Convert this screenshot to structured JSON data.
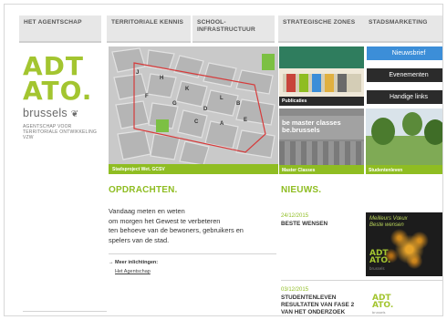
{
  "nav": {
    "items": [
      {
        "label": "HET AGENTSCHAP"
      },
      {
        "label": "TERRITORIALE KENNIS"
      },
      {
        "label": "SCHOOL-\nINFRASTRUCTUUR"
      },
      {
        "label": "STRATEGISCHE ZONES"
      },
      {
        "label": "STADSMARKETING"
      }
    ]
  },
  "logo": {
    "line1": "ADT",
    "line2": "ATO.",
    "city": "brussels",
    "subtitle": "AGENTSCHAP VOOR TERRITORIALE ONTWIKKELING VZW"
  },
  "map": {
    "caption": "Stadsproject Wet. GCSV",
    "block_labels": [
      "J",
      "H",
      "K",
      "F",
      "G",
      "L",
      "B",
      "D",
      "C",
      "A",
      "E"
    ]
  },
  "zones": {
    "publications_label": "Publicaties",
    "masterclass_label": "Master Classes",
    "masterclass_banner": "be master classes be.brussels",
    "studenten_label": "Studentenleven"
  },
  "stadsmarketing": {
    "buttons": [
      {
        "label": "Nieuwsbrief"
      },
      {
        "label": "Evenementen"
      },
      {
        "label": "Handige links"
      }
    ]
  },
  "opdrachten": {
    "title": "OPDRACHTEN.",
    "text_lines": [
      "Vandaag meten en weten",
      "om morgen het Gewest te verbeteren",
      "ten behoeve van de bewoners, gebruikers en",
      "spelers van de stad."
    ],
    "more_label": "→ Meer inlichtingen:",
    "more_link": "Het Agentschap"
  },
  "nieuws": {
    "title": "NIEUWS.",
    "items": [
      {
        "date": "24/12/2015",
        "headline": "BESTE WENSEN"
      },
      {
        "date": "03/12/2015",
        "headline": "STUDENTENLEVEN\nRESULTATEN VAN FASE 2\nVAN HET ONDERZOEK"
      }
    ],
    "photo_text": "Meilleurs Vœux\nBeste wensen",
    "photo_logo": "ADT\nATO.",
    "photo_logo_sub": "brussels",
    "small_logo": "ADT\nATO.",
    "small_logo_sub": "brussels"
  },
  "colors": {
    "accent": "#8fbd22",
    "nav_bg": "#e7e7e7",
    "button_blue": "#3c8ed8",
    "button_dark": "#2b2b2b"
  }
}
